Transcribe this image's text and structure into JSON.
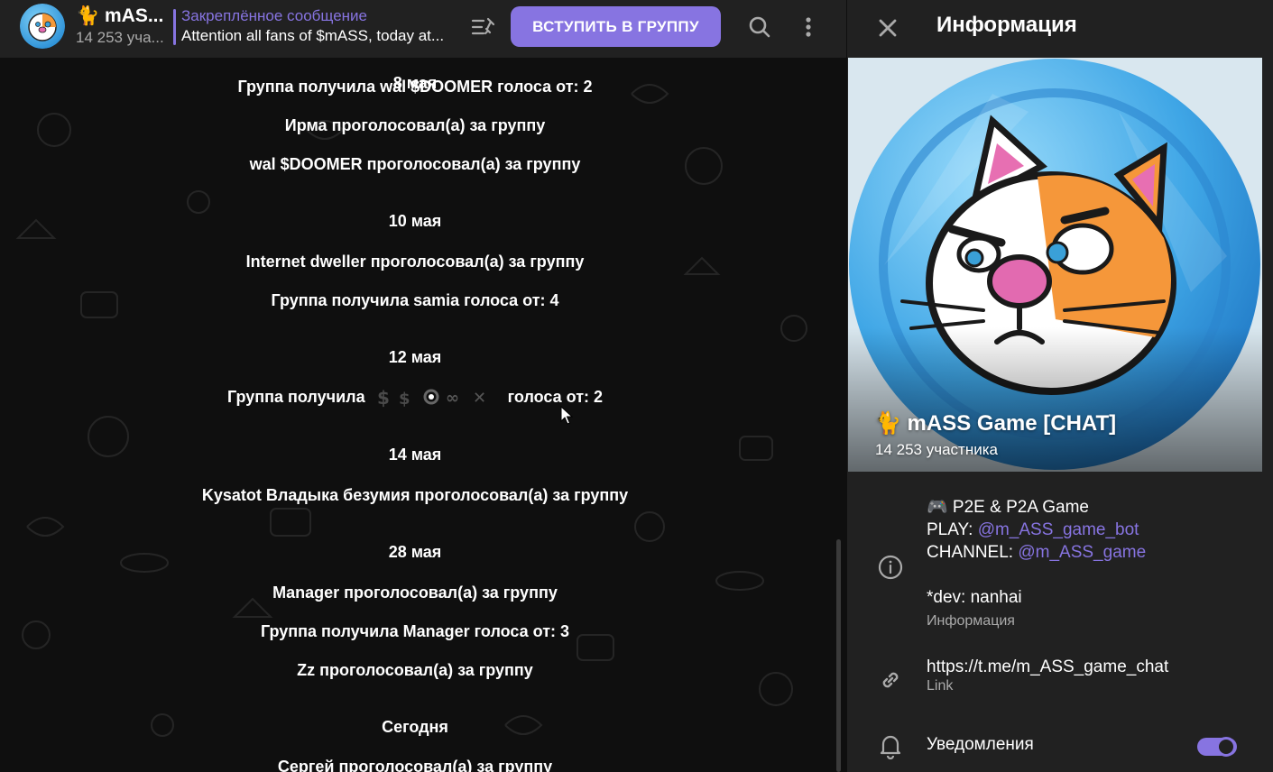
{
  "header": {
    "title": "🐈 mAS...",
    "subtitle": "14 253 уча...",
    "pinned_title": "Закреплённое сообщение",
    "pinned_text": "Attention all fans of $mASS, today at...",
    "join_label": "ВСТУПИТЬ В ГРУППУ"
  },
  "messages": [
    {
      "type": "date",
      "text": "8 мая"
    },
    {
      "type": "service",
      "text": "Группа получила wal $DOOMER голоса от: 2"
    },
    {
      "type": "service",
      "text": "Ирма проголосовал(а) за группу"
    },
    {
      "type": "service",
      "text": "wal $DOOMER проголосовал(а) за группу"
    },
    {
      "type": "date",
      "text": "10 мая"
    },
    {
      "type": "service",
      "text": "Internet dweller проголосовал(а) за группу"
    },
    {
      "type": "service",
      "text": "Группа получила samia голоса от: 4"
    },
    {
      "type": "date",
      "text": "12 мая"
    },
    {
      "type": "service",
      "text_before": "Группа получила",
      "text_after": "голоса от: 2"
    },
    {
      "type": "date",
      "text": "14 мая"
    },
    {
      "type": "service",
      "text": "Kysatot Владыка безумия проголосовал(а) за группу"
    },
    {
      "type": "date",
      "text": "28 мая"
    },
    {
      "type": "service",
      "text": "Manager проголосовал(а) за группу"
    },
    {
      "type": "service",
      "text": "Группа получила Manager голоса от: 3"
    },
    {
      "type": "service",
      "text": "Zz проголосовал(а) за группу"
    },
    {
      "type": "date",
      "text": "Сегодня"
    },
    {
      "type": "service",
      "text": "Сергей проголосовал(а) за группу"
    }
  ],
  "info": {
    "title": "Информация",
    "group_name": "🐈 mASS Game [CHAT]",
    "members": "14 253 участника",
    "desc_line1": "🎮 P2E & P2A Game",
    "desc_play_label": "PLAY: ",
    "desc_play_link": "@m_ASS_game_bot",
    "desc_channel_label": "CHANNEL: ",
    "desc_channel_link": "@m_ASS_game",
    "desc_dev": "*dev: nanhai",
    "desc_caption": "Информация",
    "link": "https://t.me/m_ASS_game_chat",
    "link_caption": "Link",
    "notifications_label": "Уведомления",
    "notifications_on": true
  },
  "colors": {
    "accent": "#8774e1",
    "header_bg": "#212121",
    "chat_bg": "#0f0f0f",
    "secondary_text": "#aaaaaa"
  }
}
